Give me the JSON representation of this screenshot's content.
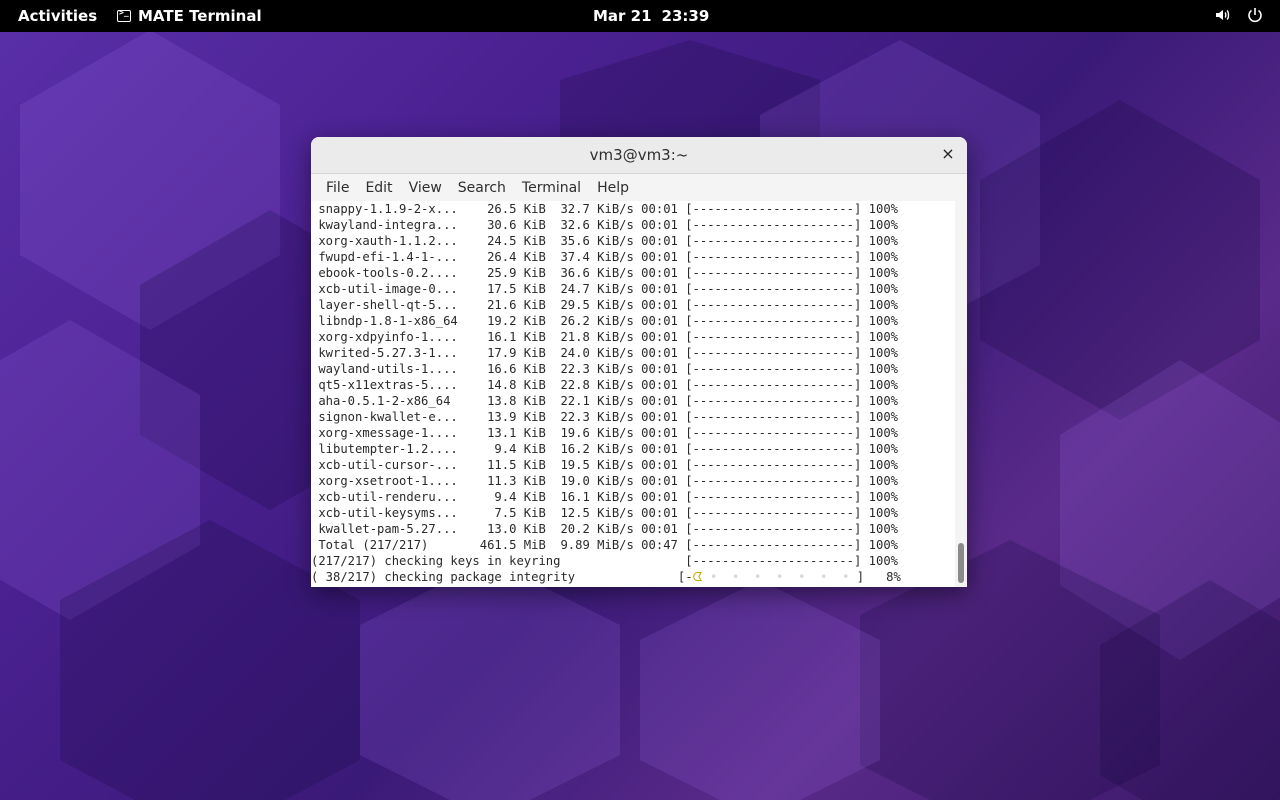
{
  "topbar": {
    "activities": "Activities",
    "app_name": "MATE Terminal",
    "date": "Mar 21",
    "time": "23:39",
    "icons": [
      "volume-icon",
      "power-icon"
    ]
  },
  "window": {
    "title": "vm3@vm3:~",
    "close_glyph": "×",
    "menu": [
      "File",
      "Edit",
      "View",
      "Search",
      "Terminal",
      "Help"
    ]
  },
  "terminal": {
    "lines": [
      " snappy-1.1.9-2-x...    26.5 KiB  32.7 KiB/s 00:01 [----------------------] 100%",
      " kwayland-integra...    30.6 KiB  32.6 KiB/s 00:01 [----------------------] 100%",
      " xorg-xauth-1.1.2...    24.5 KiB  35.6 KiB/s 00:01 [----------------------] 100%",
      " fwupd-efi-1.4-1-...    26.4 KiB  37.4 KiB/s 00:01 [----------------------] 100%",
      " ebook-tools-0.2....    25.9 KiB  36.6 KiB/s 00:01 [----------------------] 100%",
      " xcb-util-image-0...    17.5 KiB  24.7 KiB/s 00:01 [----------------------] 100%",
      " layer-shell-qt-5...    21.6 KiB  29.5 KiB/s 00:01 [----------------------] 100%",
      " libndp-1.8-1-x86_64    19.2 KiB  26.2 KiB/s 00:01 [----------------------] 100%",
      " xorg-xdpyinfo-1....    16.1 KiB  21.8 KiB/s 00:01 [----------------------] 100%",
      " kwrited-5.27.3-1...    17.9 KiB  24.0 KiB/s 00:01 [----------------------] 100%",
      " wayland-utils-1....    16.6 KiB  22.3 KiB/s 00:01 [----------------------] 100%",
      " qt5-x11extras-5....    14.8 KiB  22.8 KiB/s 00:01 [----------------------] 100%",
      " aha-0.5.1-2-x86_64     13.8 KiB  22.1 KiB/s 00:01 [----------------------] 100%",
      " signon-kwallet-e...    13.9 KiB  22.3 KiB/s 00:01 [----------------------] 100%",
      " xorg-xmessage-1....    13.1 KiB  19.6 KiB/s 00:01 [----------------------] 100%",
      " libutempter-1.2....     9.4 KiB  16.2 KiB/s 00:01 [----------------------] 100%",
      " xcb-util-cursor-...    11.5 KiB  19.5 KiB/s 00:01 [----------------------] 100%",
      " xorg-xsetroot-1....    11.3 KiB  19.0 KiB/s 00:01 [----------------------] 100%",
      " xcb-util-renderu...     9.4 KiB  16.1 KiB/s 00:01 [----------------------] 100%",
      " xcb-util-keysyms...     7.5 KiB  12.5 KiB/s 00:01 [----------------------] 100%",
      " kwallet-pam-5.27...    13.0 KiB  20.2 KiB/s 00:01 [----------------------] 100%",
      " Total (217/217)       461.5 MiB  9.89 MiB/s 00:47 [----------------------] 100%",
      "(217/217) checking keys in keyring                 [----------------------] 100%"
    ],
    "last_line_prefix": "( 38/217) checking package integrity              [-",
    "last_line_pacman": "ᗧ",
    "last_line_dots": " •  •  •  •  •  •  • ",
    "last_line_suffix": "]   8%"
  },
  "colors": {
    "pacman": "#c8a800",
    "topbar_bg": "#000000",
    "wallpaper_primary": "#4a2090"
  }
}
